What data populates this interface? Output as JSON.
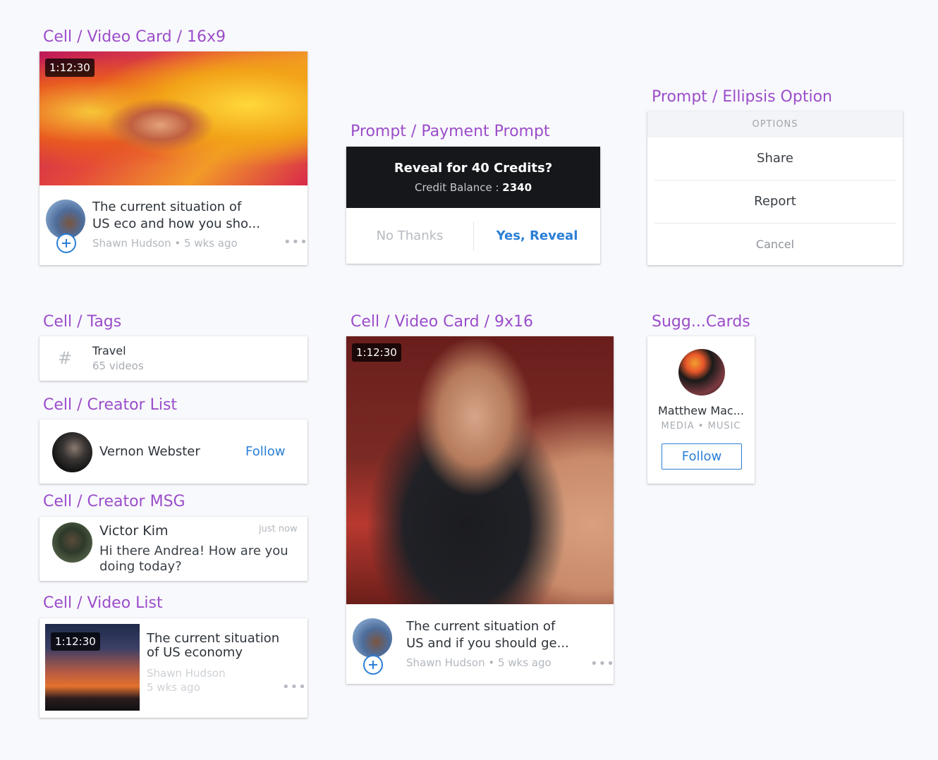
{
  "sections": {
    "video_card_16x9": "Cell / Video Card / 16x9",
    "payment_prompt": "Prompt / Payment Prompt",
    "ellipsis_option": "Prompt / Ellipsis Option",
    "tags": "Cell / Tags",
    "video_card_9x16": "Cell / Video Card / 9x16",
    "sugg_cards": "Sugg...Cards",
    "creator_list": "Cell / Creator List",
    "creator_msg": "Cell / Creator MSG",
    "video_list": "Cell / Video List"
  },
  "video_card_16x9": {
    "duration": "1:12:30",
    "title_line1": "The current situation of",
    "title_line2": "US eco and how you sho...",
    "meta": "Shawn Hudson • 5 wks ago"
  },
  "payment_prompt": {
    "title": "Reveal for 40 Credits?",
    "balance_label": "Credit Balance :",
    "balance_value": "2340",
    "no_label": "No Thanks",
    "yes_label": "Yes, Reveal"
  },
  "ellipsis_option": {
    "header": "OPTIONS",
    "share": "Share",
    "report": "Report",
    "cancel": "Cancel"
  },
  "tag": {
    "symbol": "#",
    "name": "Travel",
    "count": "65 videos"
  },
  "video_card_9x16": {
    "duration": "1:12:30",
    "title_line1": "The current situation of",
    "title_line2": "US and if you should ge...",
    "meta": "Shawn Hudson • 5 wks ago"
  },
  "suggested_card": {
    "name": "Matthew Mac...",
    "category": "MEDIA • MUSIC",
    "follow_label": "Follow"
  },
  "creator_list": {
    "name": "Vernon Webster",
    "follow_label": "Follow"
  },
  "creator_msg": {
    "name": "Victor Kim",
    "time": "just now",
    "message_line1": "Hi there Andrea! How are you",
    "message_line2": "doing today?"
  },
  "video_list": {
    "duration": "1:12:30",
    "title_line1": "The current situation",
    "title_line2": "of US economy",
    "author": "Shawn Hudson",
    "time": "5 wks ago"
  },
  "colors": {
    "section_label": "#9b4dca",
    "accent": "#2a7fd6",
    "prompt_dark": "#15171b"
  }
}
